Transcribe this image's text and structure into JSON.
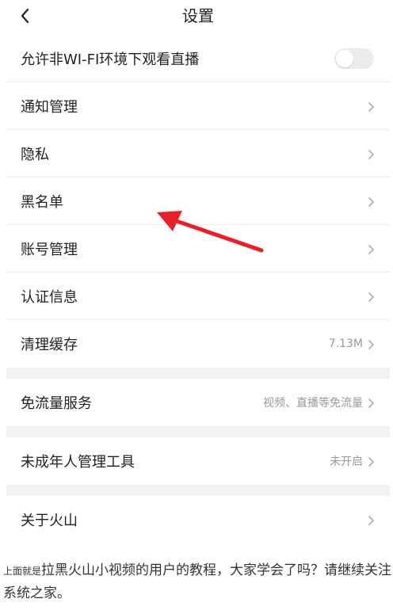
{
  "header": {
    "title": "设置",
    "back_icon": "chevron-left-icon"
  },
  "settings": {
    "wifi_toggle": {
      "label": "允许非WI-FI环境下观看直播",
      "state": "off"
    },
    "group1": [
      {
        "label": "通知管理"
      },
      {
        "label": "隐私"
      },
      {
        "label": "黑名单"
      },
      {
        "label": "账号管理"
      },
      {
        "label": "认证信息"
      },
      {
        "label": "清理缓存",
        "value": "7.13M"
      }
    ],
    "free_traffic": {
      "label": "免流量服务",
      "value": "视频、直播等免流量"
    },
    "minor_tool": {
      "label": "未成年人管理工具",
      "value": "未开启"
    },
    "about": {
      "label": "关于火山"
    }
  },
  "annotation": {
    "arrow_color": "#e8202a",
    "target": "黑名单"
  },
  "caption": {
    "prefix": "上面就是",
    "text": "拉黑火山小视频的用户的教程，大家学会了吗？请继续关注系统之家。"
  }
}
